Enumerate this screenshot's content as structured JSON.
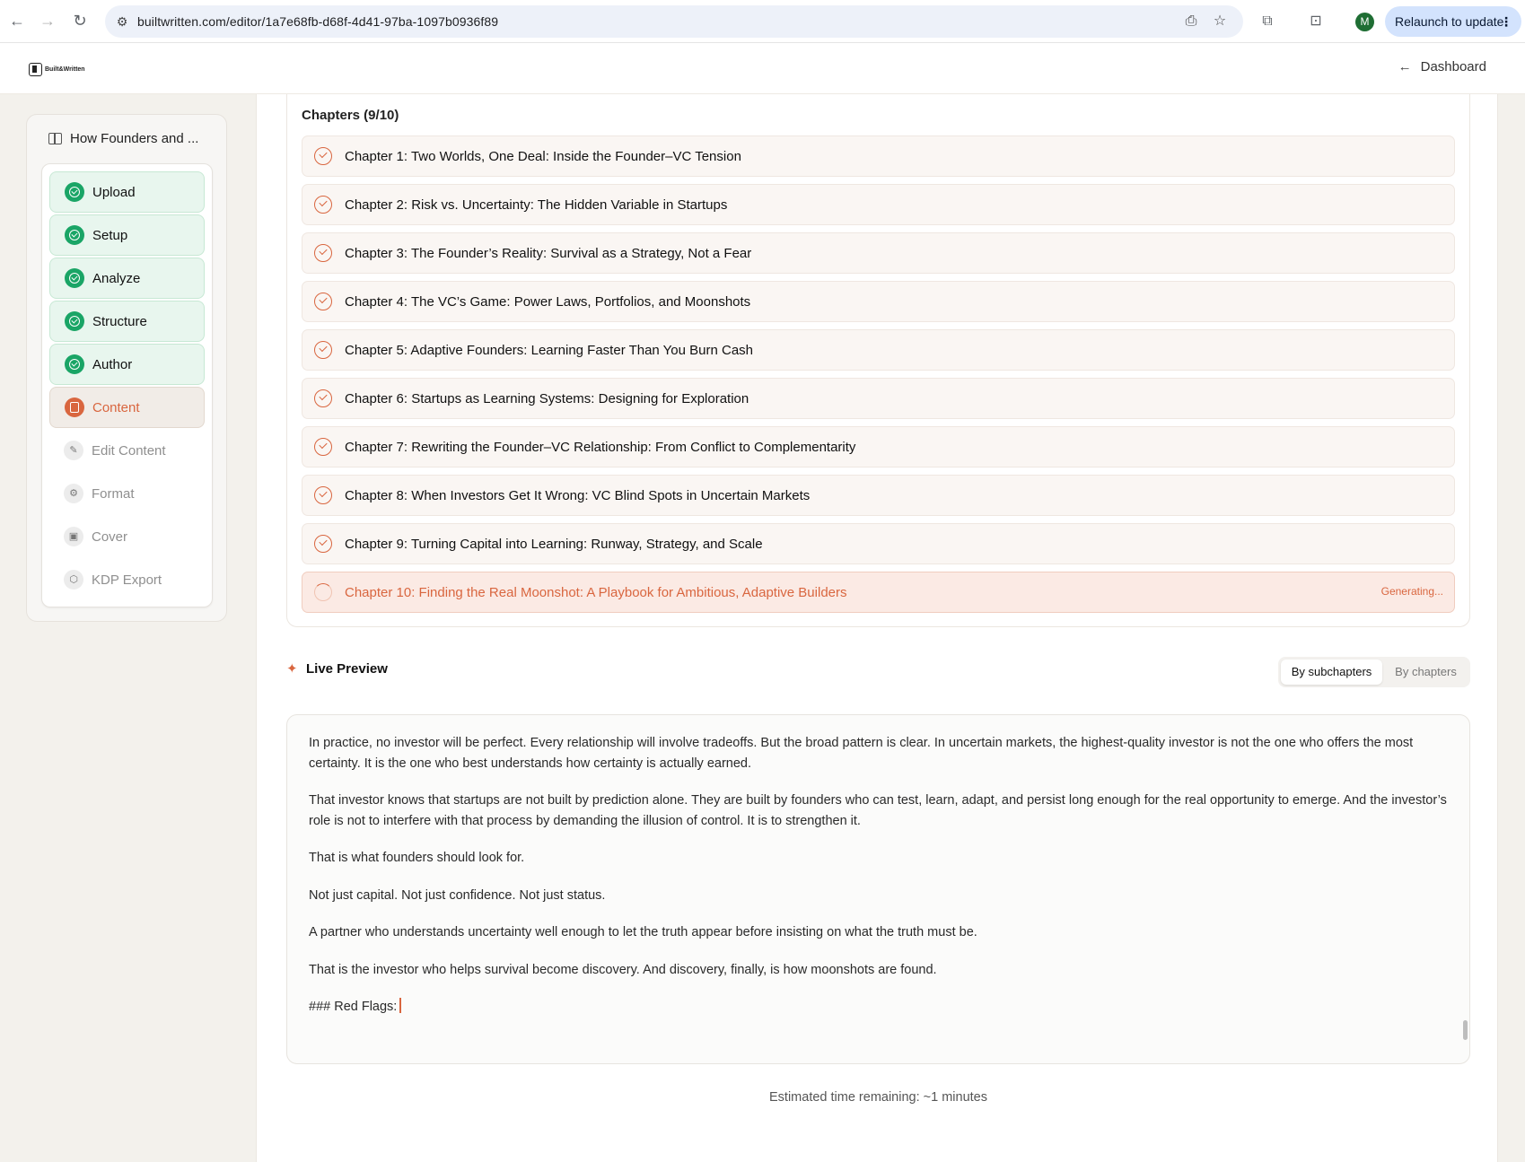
{
  "browser": {
    "url": "builtwritten.com/editor/1a7e68fb-d68f-4d41-97ba-1097b0936f89",
    "profile_initial": "M",
    "relaunch_label": "Relaunch to update",
    "icons": [
      "back-icon",
      "forward-icon",
      "reload-icon",
      "site-settings-icon",
      "install-icon",
      "bookmark-star-icon",
      "extensions-icon",
      "tab-search-icon",
      "menu-dots-icon"
    ]
  },
  "header": {
    "logo_text": "Built&Written",
    "dashboard_label": "Dashboard"
  },
  "sidebar": {
    "book_title": "How Founders and ...",
    "steps": [
      {
        "label": "Upload",
        "state": "done"
      },
      {
        "label": "Setup",
        "state": "done"
      },
      {
        "label": "Analyze",
        "state": "done"
      },
      {
        "label": "Structure",
        "state": "done"
      },
      {
        "label": "Author",
        "state": "done"
      },
      {
        "label": "Content",
        "state": "active"
      },
      {
        "label": "Edit Content",
        "state": "pending"
      },
      {
        "label": "Format",
        "state": "pending"
      },
      {
        "label": "Cover",
        "state": "pending"
      },
      {
        "label": "KDP Export",
        "state": "pending"
      }
    ]
  },
  "chapters": {
    "title": "Chapters (9/10)",
    "items": [
      {
        "label": "Chapter 1: Two Worlds, One Deal: Inside the Founder–VC Tension",
        "status": "done"
      },
      {
        "label": "Chapter 2: Risk vs. Uncertainty: The Hidden Variable in Startups",
        "status": "done"
      },
      {
        "label": "Chapter 3: The Founder’s Reality: Survival as a Strategy, Not a Fear",
        "status": "done"
      },
      {
        "label": "Chapter 4: The VC’s Game: Power Laws, Portfolios, and Moonshots",
        "status": "done"
      },
      {
        "label": "Chapter 5: Adaptive Founders: Learning Faster Than You Burn Cash",
        "status": "done"
      },
      {
        "label": "Chapter 6: Startups as Learning Systems: Designing for Exploration",
        "status": "done"
      },
      {
        "label": "Chapter 7: Rewriting the Founder–VC Relationship: From Conflict to Complementarity",
        "status": "done"
      },
      {
        "label": "Chapter 8: When Investors Get It Wrong: VC Blind Spots in Uncertain Markets",
        "status": "done"
      },
      {
        "label": "Chapter 9: Turning Capital into Learning: Runway, Strategy, and Scale",
        "status": "done"
      },
      {
        "label": "Chapter 10: Finding the Real Moonshot: A Playbook for Ambitious, Adaptive Builders",
        "status": "generating",
        "status_label": "Generating..."
      }
    ]
  },
  "live_preview": {
    "title": "Live Preview",
    "toggle": {
      "active": "By subchapters",
      "inactive": "By chapters"
    },
    "paragraphs": [
      "In practice, no investor will be perfect. Every relationship will involve tradeoffs. But the broad pattern is clear. In uncertain markets, the highest-quality investor is not the one who offers the most certainty. It is the one who best understands how certainty is actually earned.",
      "That investor knows that startups are not built by prediction alone. They are built by founders who can test, learn, adapt, and persist long enough for the real opportunity to emerge. And the investor’s role is not to interfere with that process by demanding the illusion of control. It is to strengthen it.",
      "That is what founders should look for.",
      "Not just capital. Not just confidence. Not just status.",
      "A partner who understands uncertainty well enough to let the truth appear before insisting on what the truth must be.",
      "That is the investor who helps survival become discovery. And discovery, finally, is how moonshots are found.",
      "### Red Flags:"
    ]
  },
  "eta": "Estimated time remaining: ~1 minutes",
  "colors": {
    "accent": "#d9663f",
    "success": "#1aa566",
    "done_bg": "#e8f6ee"
  }
}
